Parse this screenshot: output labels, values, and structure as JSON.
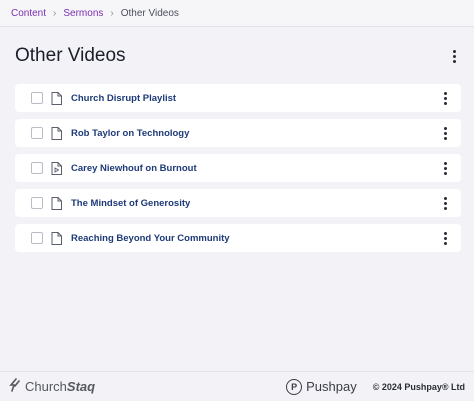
{
  "breadcrumb": {
    "items": [
      {
        "label": "Content"
      },
      {
        "label": "Sermons"
      }
    ],
    "current": "Other Videos"
  },
  "page": {
    "title": "Other Videos",
    "menu_icon": "kebab-vertical-icon"
  },
  "items": [
    {
      "title": "Church Disrupt Playlist",
      "icon": "document-icon"
    },
    {
      "title": "Rob Taylor on Technology",
      "icon": "document-icon"
    },
    {
      "title": "Carey Niewhouf on Burnout",
      "icon": "video-document-icon"
    },
    {
      "title": "The Mindset of Generosity",
      "icon": "document-icon"
    },
    {
      "title": "Reaching Beyond Your Community",
      "icon": "document-icon"
    }
  ],
  "footer": {
    "brand_prefix": "Church",
    "brand_suffix": "Staq",
    "pushpay_label": "Pushpay",
    "pushpay_mark": "P",
    "copyright": "© 2024 Pushpay® Ltd"
  },
  "colors": {
    "link": "#7b2fb0",
    "item_title": "#1e3a78",
    "background": "#f3f3f7"
  }
}
